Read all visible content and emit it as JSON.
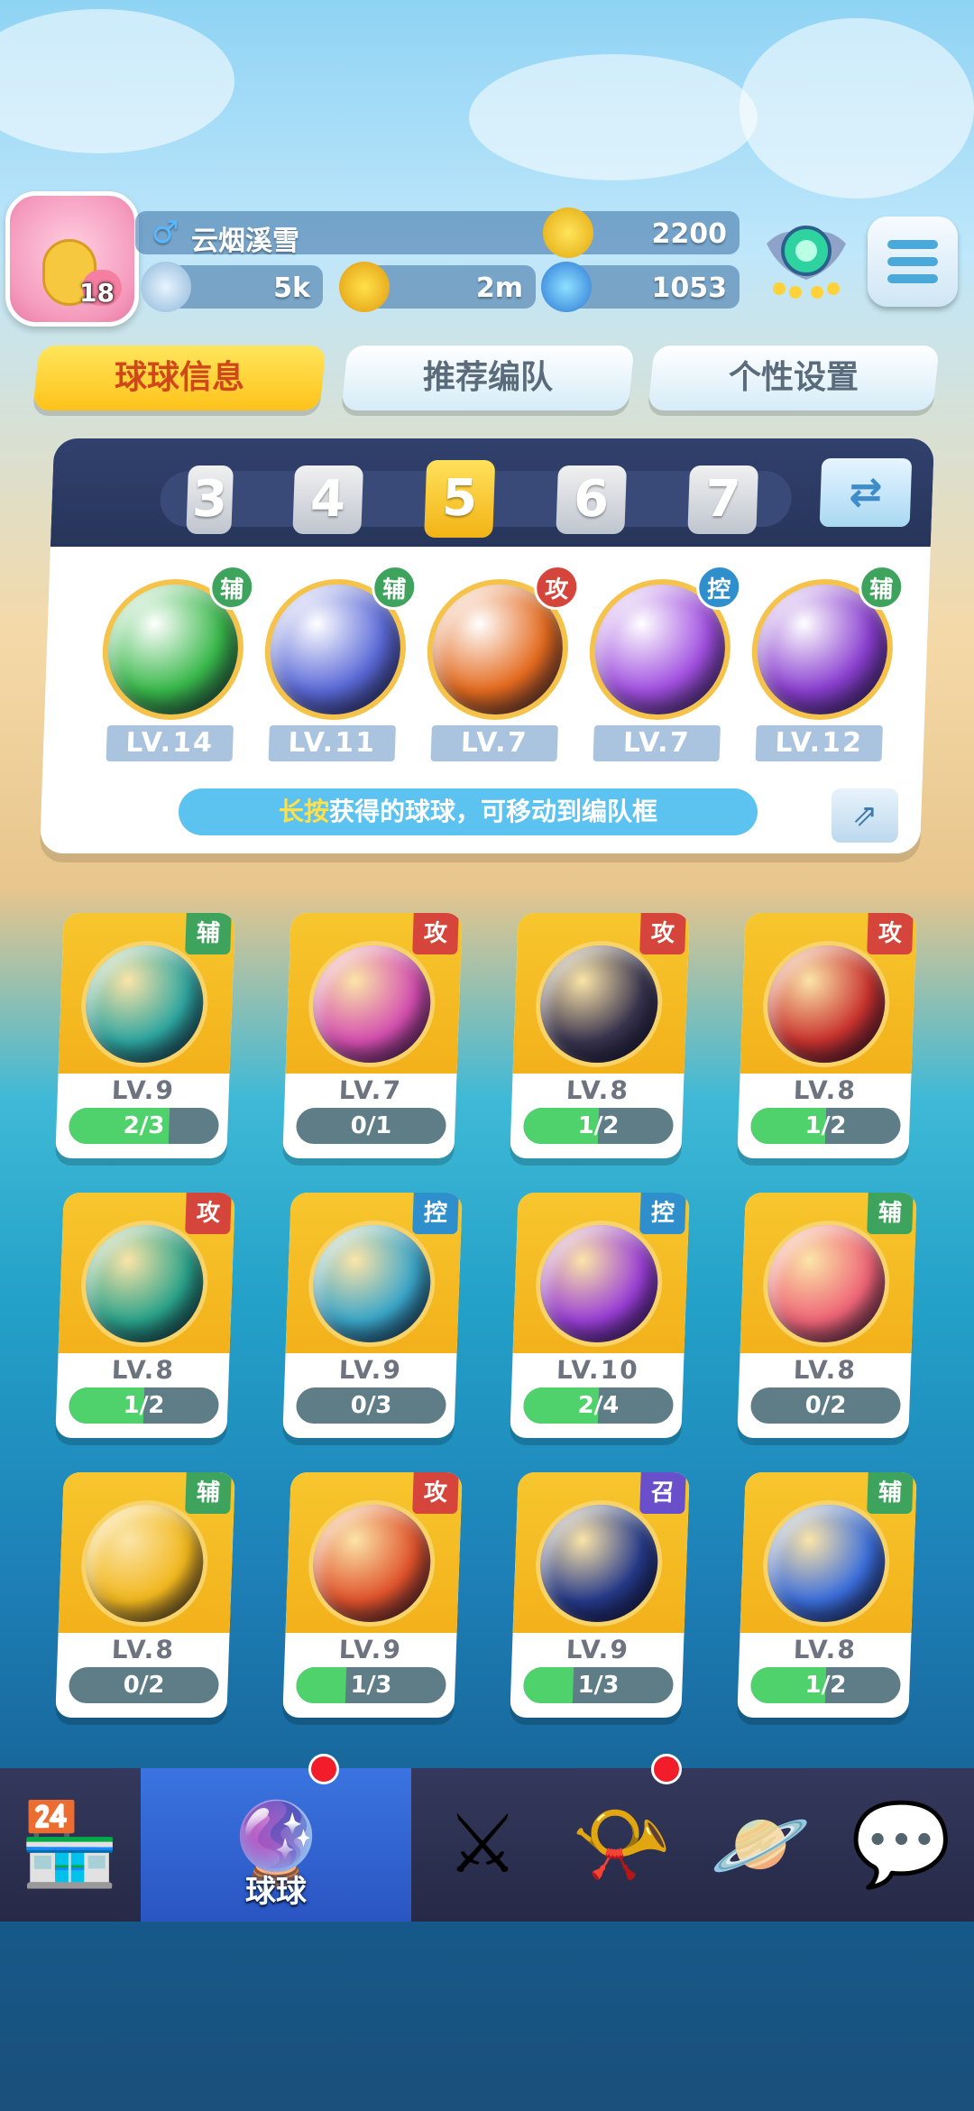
{
  "player": {
    "name": "云烟溪雪",
    "level": "18",
    "trophies": "2200",
    "stat_energy": "5k",
    "stat_coins": "2m",
    "stat_diamonds": "1053",
    "gender_icon": "male-icon"
  },
  "tabs": [
    {
      "label": "球球信息",
      "active": true
    },
    {
      "label": "推荐编队",
      "active": false
    },
    {
      "label": "个性设置",
      "active": false
    }
  ],
  "team_slots": [
    "3",
    "4",
    "5",
    "6",
    "7"
  ],
  "active_slot": "5",
  "team": [
    {
      "role": "辅",
      "level": "LV.14",
      "color": "#38b84a"
    },
    {
      "role": "辅",
      "level": "LV.11",
      "color": "#5b6ad8"
    },
    {
      "role": "攻",
      "level": "LV.7",
      "color": "#e46a1e"
    },
    {
      "role": "控",
      "level": "LV.7",
      "color": "#a150e0"
    },
    {
      "role": "辅",
      "level": "LV.12",
      "color": "#8a3fd0"
    }
  ],
  "hint": {
    "highlight": "长按",
    "text": "获得的球球，可移动到编队框"
  },
  "cards": [
    {
      "role": "辅",
      "level": "LV.9",
      "progress": "2/3",
      "fill": 0.667,
      "color": "#2ea6a0"
    },
    {
      "role": "攻",
      "level": "LV.7",
      "progress": "0/1",
      "fill": 0,
      "color": "#d54fb0"
    },
    {
      "role": "攻",
      "level": "LV.8",
      "progress": "1/2",
      "fill": 0.5,
      "color": "#3a3550"
    },
    {
      "role": "攻",
      "level": "LV.8",
      "progress": "1/2",
      "fill": 0.5,
      "color": "#c9322e"
    },
    {
      "role": "攻",
      "level": "LV.8",
      "progress": "1/2",
      "fill": 0.5,
      "color": "#2aa38a"
    },
    {
      "role": "控",
      "level": "LV.9",
      "progress": "0/3",
      "fill": 0,
      "color": "#3aa6c9"
    },
    {
      "role": "控",
      "level": "LV.10",
      "progress": "2/4",
      "fill": 0.5,
      "color": "#9a3fd6"
    },
    {
      "role": "辅",
      "level": "LV.8",
      "progress": "0/2",
      "fill": 0,
      "color": "#ef6577"
    },
    {
      "role": "辅",
      "level": "LV.8",
      "progress": "0/2",
      "fill": 0,
      "color": "#f2b81e"
    },
    {
      "role": "攻",
      "level": "LV.9",
      "progress": "1/3",
      "fill": 0.333,
      "color": "#e0532b"
    },
    {
      "role": "召",
      "level": "LV.9",
      "progress": "1/3",
      "fill": 0.333,
      "color": "#263a8a"
    },
    {
      "role": "辅",
      "level": "LV.8",
      "progress": "1/2",
      "fill": 0.5,
      "color": "#3c6fdc"
    }
  ],
  "nav": [
    {
      "icon": "shop-icon",
      "glyph": "🏪",
      "label": ""
    },
    {
      "icon": "balls-icon",
      "glyph": "🔮",
      "label": "球球",
      "active": true,
      "badge": true
    },
    {
      "icon": "battle-swords-icon",
      "glyph": "⚔",
      "label": ""
    },
    {
      "icon": "whistle-icon",
      "glyph": "📯",
      "label": "",
      "badge": true
    },
    {
      "icon": "planet-icon",
      "glyph": "🪐",
      "label": ""
    },
    {
      "icon": "chat-heart-icon",
      "glyph": "💬",
      "label": ""
    }
  ]
}
